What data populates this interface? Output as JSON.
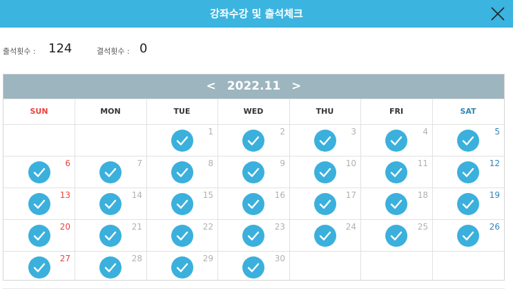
{
  "header": {
    "title": "강좌수강 및 출석체크",
    "close_icon": "close-icon"
  },
  "stats": {
    "attend_label": "출석횟수 :",
    "attend_value": "124",
    "absent_label": "결석횟수 :",
    "absent_value": "0"
  },
  "calendar": {
    "prev": "<",
    "next": ">",
    "month": "2022.11",
    "weekdays": [
      "SUN",
      "MON",
      "TUE",
      "WED",
      "THU",
      "FRI",
      "SAT"
    ],
    "weeks": [
      [
        null,
        null,
        {
          "day": "1",
          "checked": true
        },
        {
          "day": "2",
          "checked": true
        },
        {
          "day": "3",
          "checked": true
        },
        {
          "day": "4",
          "checked": true
        },
        {
          "day": "5",
          "checked": true
        }
      ],
      [
        {
          "day": "6",
          "checked": true
        },
        {
          "day": "7",
          "checked": true
        },
        {
          "day": "8",
          "checked": true
        },
        {
          "day": "9",
          "checked": true
        },
        {
          "day": "10",
          "checked": true
        },
        {
          "day": "11",
          "checked": true
        },
        {
          "day": "12",
          "checked": true
        }
      ],
      [
        {
          "day": "13",
          "checked": true
        },
        {
          "day": "14",
          "checked": true
        },
        {
          "day": "15",
          "checked": true
        },
        {
          "day": "16",
          "checked": true
        },
        {
          "day": "17",
          "checked": true
        },
        {
          "day": "18",
          "checked": true
        },
        {
          "day": "19",
          "checked": true
        }
      ],
      [
        {
          "day": "20",
          "checked": true
        },
        {
          "day": "21",
          "checked": true
        },
        {
          "day": "22",
          "checked": true
        },
        {
          "day": "23",
          "checked": true
        },
        {
          "day": "24",
          "checked": true
        },
        {
          "day": "25",
          "checked": true
        },
        {
          "day": "26",
          "checked": true
        }
      ],
      [
        {
          "day": "27",
          "checked": true
        },
        {
          "day": "28",
          "checked": true
        },
        {
          "day": "29",
          "checked": true
        },
        {
          "day": "30",
          "checked": true
        },
        null,
        null,
        null
      ]
    ]
  },
  "colors": {
    "header": "#3bb4df",
    "month_bar": "#9cb5bf",
    "check": "#3bb0dc",
    "sunday": "#e8413d",
    "saturday": "#2f84b8"
  }
}
